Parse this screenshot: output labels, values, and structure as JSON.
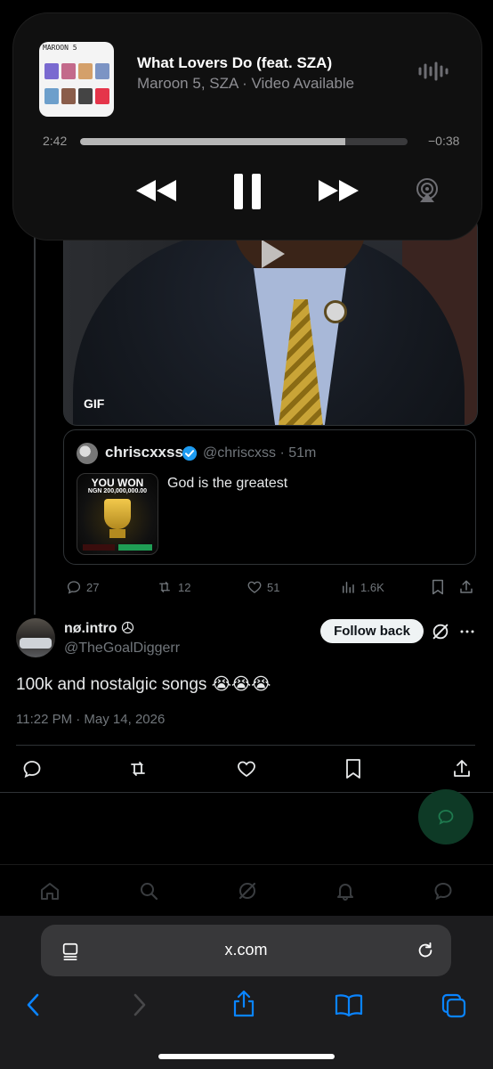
{
  "now_playing": {
    "album_art_title": "MAROON 5",
    "title": "What Lovers Do (feat. SZA)",
    "artist": "Maroon 5, SZA · Video Available",
    "elapsed": "2:42",
    "remaining": "−0:38",
    "progress": 0.81
  },
  "media": {
    "badge": "GIF"
  },
  "quoted_post": {
    "name": "chriscxxss",
    "handle_time": "@chriscxss · 51m",
    "text": "God is the greatest",
    "thumb_heading": "YOU WON",
    "thumb_amount": "NGN 200,000,000.00"
  },
  "post_actions": {
    "replies": "27",
    "reposts": "12",
    "likes": "51",
    "views": "1.6K"
  },
  "reply": {
    "name": "nø.intro",
    "handle": "@TheGoalDiggerr",
    "follow_label": "Follow back",
    "text": "100k and nostalgic songs 😭😭😭",
    "timestamp": "11:22 PM · May 14, 2026"
  },
  "browser": {
    "url": "x.com"
  },
  "colors": {
    "accent": "#1d9bf0",
    "safari_blue": "#0a84ff",
    "muted": "#71767b",
    "fab": "#0e3a26"
  }
}
